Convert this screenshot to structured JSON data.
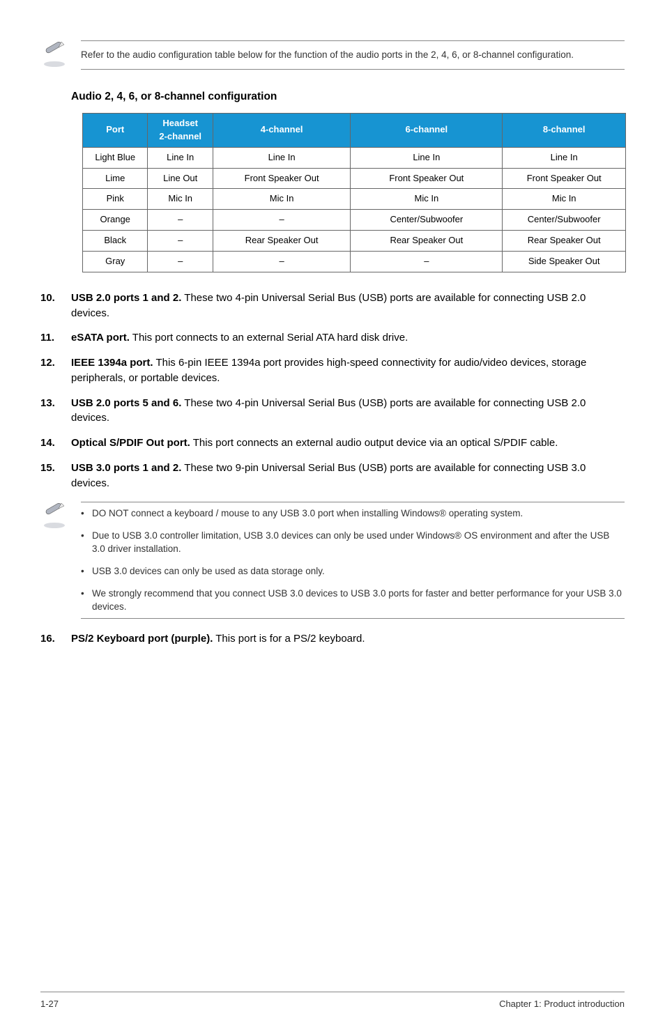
{
  "note1": "Refer to the audio configuration table below for the function of the audio ports in the 2, 4, 6, or 8-channel configuration.",
  "section_title": "Audio 2, 4, 6, or 8-channel configuration",
  "table": {
    "headers": [
      "Port",
      "Headset\n2-channel",
      "4-channel",
      "6-channel",
      "8-channel"
    ],
    "rows": [
      [
        "Light Blue",
        "Line In",
        "Line In",
        "Line In",
        "Line In"
      ],
      [
        "Lime",
        "Line Out",
        "Front Speaker Out",
        "Front Speaker Out",
        "Front Speaker Out"
      ],
      [
        "Pink",
        "Mic In",
        "Mic In",
        "Mic In",
        "Mic In"
      ],
      [
        "Orange",
        "–",
        "–",
        "Center/Subwoofer",
        "Center/Subwoofer"
      ],
      [
        "Black",
        "–",
        "Rear Speaker Out",
        "Rear Speaker Out",
        "Rear Speaker Out"
      ],
      [
        "Gray",
        "–",
        "–",
        "–",
        "Side Speaker Out"
      ]
    ]
  },
  "items": {
    "i10": {
      "n": "10.",
      "b": "USB 2.0 ports 1 and 2.",
      "t": " These two 4-pin Universal Serial Bus (USB) ports are available for connecting USB 2.0 devices."
    },
    "i11": {
      "n": "11.",
      "b": "eSATA port.",
      "t": " This port connects to an external Serial ATA hard disk drive."
    },
    "i12": {
      "n": "12.",
      "b": "IEEE 1394a port.",
      "t": " This 6-pin IEEE 1394a port provides high-speed connectivity for audio/video devices, storage peripherals, or portable devices."
    },
    "i13": {
      "n": "13.",
      "b": "USB 2.0 ports 5 and 6.",
      "t": " These two 4-pin Universal Serial Bus (USB) ports are available for connecting USB 2.0 devices."
    },
    "i14": {
      "n": "14.",
      "b": "Optical S/PDIF Out port.",
      "t": " This port connects an external audio output device via an optical S/PDIF cable."
    },
    "i15": {
      "n": "15.",
      "b": "USB 3.0 ports 1 and 2.",
      "t": " These two 9-pin Universal Serial Bus (USB) ports are available for connecting USB 3.0 devices."
    },
    "i16": {
      "n": "16.",
      "b": "PS/2 Keyboard port (purple).",
      "t": " This port is for a PS/2 keyboard."
    }
  },
  "bullets": [
    "DO NOT connect a keyboard / mouse to any USB 3.0 port when installing Windows® operating system.",
    "Due to USB 3.0 controller limitation, USB 3.0 devices can only be used under Windows® OS environment and after the USB 3.0 driver installation.",
    "USB 3.0 devices can only be used as data storage only.",
    "We strongly recommend that you connect USB 3.0 devices to USB 3.0 ports for faster and better performance for your USB 3.0 devices."
  ],
  "footer": {
    "left": "1-27",
    "right": "Chapter 1: Product introduction"
  }
}
